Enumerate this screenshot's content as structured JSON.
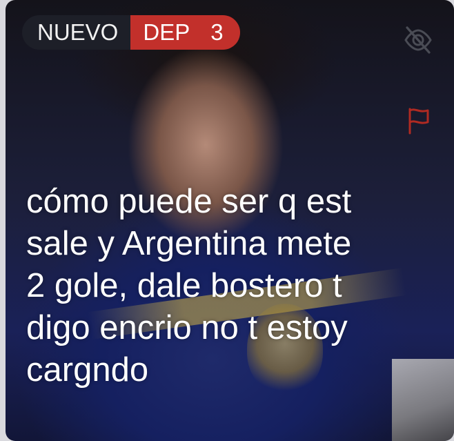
{
  "badge": {
    "new_label": "NUEVO",
    "category_label": "DEP",
    "count": "3",
    "new_bg": "#1d1f28",
    "category_bg": "#c2302b"
  },
  "icons": {
    "hide": "eye-slash-icon",
    "report": "flag-icon",
    "report_color": "#b02a22"
  },
  "post": {
    "lines": [
      "cómo puede ser q est",
      "sale y Argentina mete",
      "2 gole, dale bostero t",
      "digo encrio no t estoy",
      "cargndo"
    ]
  }
}
